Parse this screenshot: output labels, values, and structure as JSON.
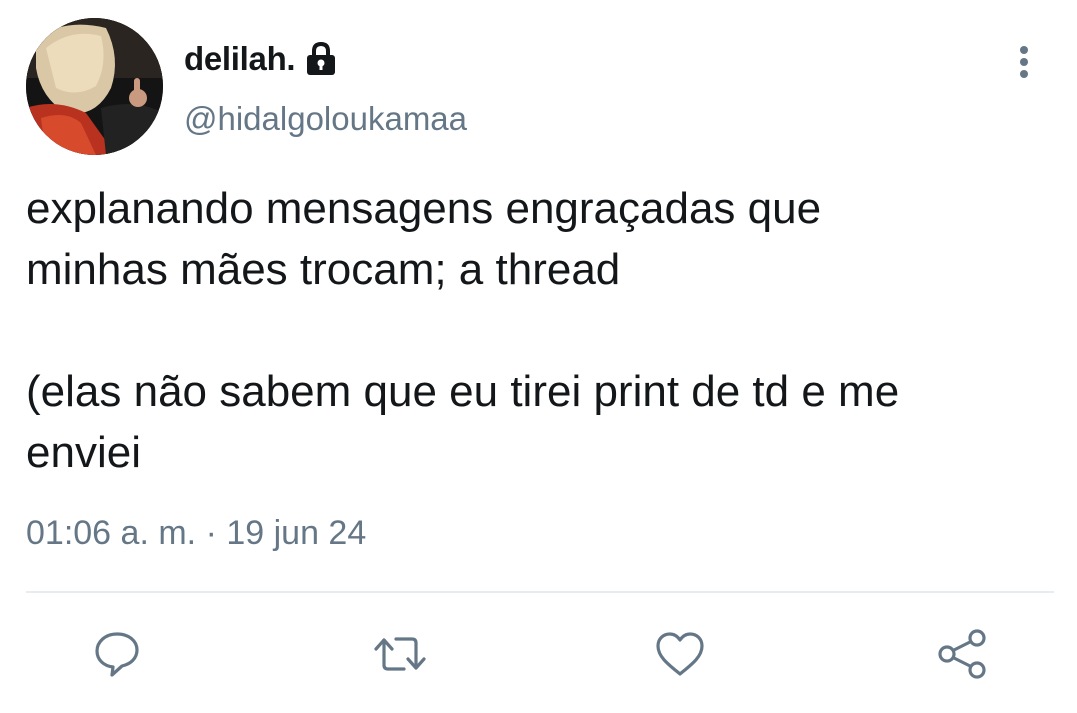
{
  "user": {
    "display_name": "delilah.",
    "handle": "@hidalgoloukamaa",
    "protected_icon": "lock-icon",
    "avatar": "profile-photo"
  },
  "tweet": {
    "paragraphs": [
      [
        "explanando mensagens engraçadas que",
        "minhas mães trocam; a thread"
      ],
      [
        "(elas não sabem que eu tirei print de td e me",
        "enviei"
      ]
    ],
    "time": "01:06 a. m.",
    "separator": "·",
    "date": "19 jun 24"
  },
  "actions": [
    {
      "name": "reply",
      "icon": "speech-bubble-icon"
    },
    {
      "name": "retweet",
      "icon": "retweet-arrows-icon"
    },
    {
      "name": "like",
      "icon": "heart-icon"
    },
    {
      "name": "share",
      "icon": "share-nodes-icon"
    }
  ],
  "colors": {
    "text": "#14171a",
    "secondary": "#657786",
    "divider": "#e6ecf0"
  }
}
